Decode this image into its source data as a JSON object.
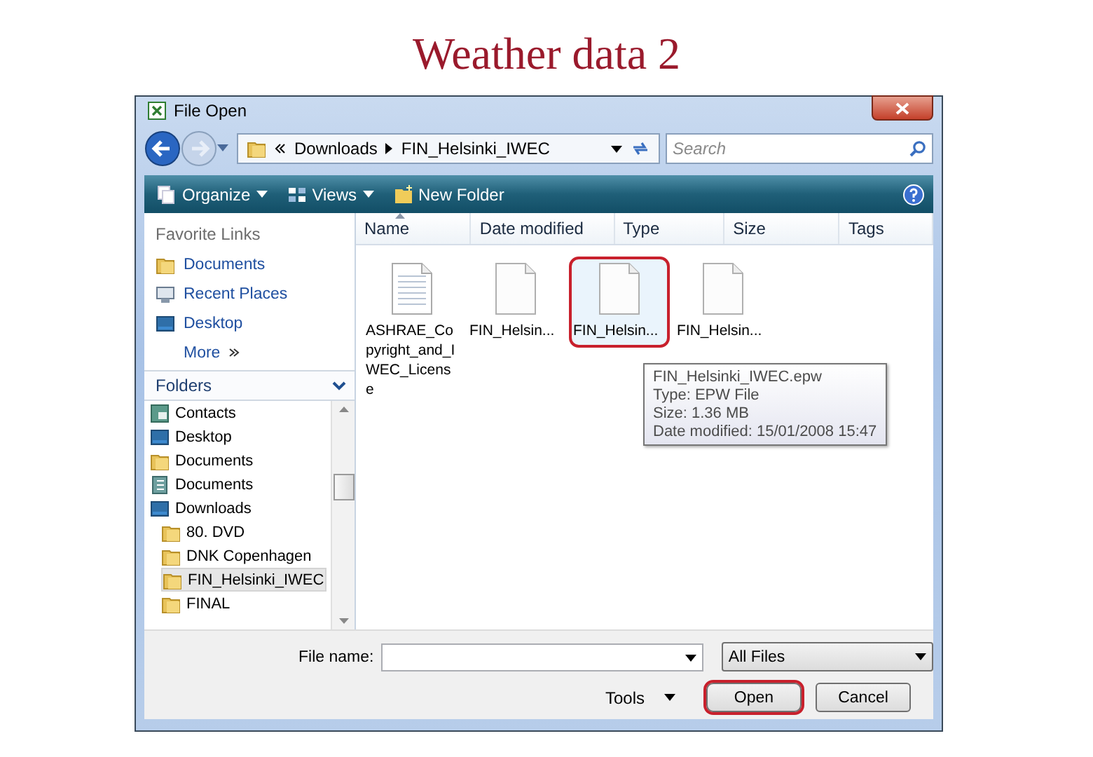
{
  "slide": {
    "title": "Weather data 2"
  },
  "window": {
    "title": "File Open"
  },
  "address": {
    "crumbs": [
      "Downloads",
      "FIN_Helsinki_IWEC"
    ]
  },
  "search": {
    "placeholder": "Search"
  },
  "toolbar": [
    {
      "label": "Organize",
      "kind": "organize",
      "dropdown": true
    },
    {
      "label": "Views",
      "kind": "views",
      "dropdown": true
    },
    {
      "label": "New Folder",
      "kind": "new-folder",
      "dropdown": false
    }
  ],
  "favorite_links": {
    "title": "Favorite Links",
    "items": [
      {
        "label": "Documents",
        "kind": "folder"
      },
      {
        "label": "Recent Places",
        "kind": "recent"
      },
      {
        "label": "Desktop",
        "kind": "desktop"
      }
    ],
    "more": "More"
  },
  "folders": {
    "title": "Folders",
    "expanded": true,
    "items": [
      {
        "label": "Contacts",
        "kind": "contacts",
        "selected": false
      },
      {
        "label": "Desktop",
        "kind": "desktop",
        "selected": false
      },
      {
        "label": "Documents",
        "kind": "folder",
        "selected": false
      },
      {
        "label": "Documents",
        "kind": "library",
        "selected": false
      },
      {
        "label": "Downloads",
        "kind": "desktop",
        "selected": false,
        "children": [
          {
            "label": "80. DVD",
            "kind": "folder",
            "selected": false
          },
          {
            "label": "DNK Copenhagen",
            "kind": "folder",
            "selected": false
          },
          {
            "label": "FIN_Helsinki_IWEC",
            "kind": "folder",
            "selected": true
          },
          {
            "label": "FINAL",
            "kind": "folder",
            "selected": false
          }
        ]
      }
    ]
  },
  "columns": [
    {
      "label": "Name",
      "sorted": true
    },
    {
      "label": "Date modified",
      "sorted": false
    },
    {
      "label": "Type",
      "sorted": false
    },
    {
      "label": "Size",
      "sorted": false
    },
    {
      "label": "Tags",
      "sorted": false
    }
  ],
  "files": [
    {
      "name": "ASHRAE_Copyright_and_IWEC_License",
      "kind": "text",
      "selected": false,
      "annotated": false
    },
    {
      "name": "FIN_Helsin...",
      "kind": "blank",
      "selected": false,
      "annotated": false
    },
    {
      "name": "FIN_Helsin...",
      "kind": "blank",
      "selected": true,
      "annotated": true
    },
    {
      "name": "FIN_Helsin...",
      "kind": "blank",
      "selected": false,
      "annotated": false
    }
  ],
  "tooltip": {
    "lines": [
      "FIN_Helsinki_IWEC.epw",
      "Type: EPW File",
      "Size: 1.36 MB",
      "Date modified: 15/01/2008 15:47"
    ]
  },
  "footer": {
    "file_name": {
      "label": "File name:"
    },
    "filter": {
      "value": "All Files"
    },
    "tools": "Tools",
    "buttons": [
      {
        "label": "Open",
        "annotated": true
      },
      {
        "label": "Cancel",
        "annotated": false
      }
    ]
  }
}
